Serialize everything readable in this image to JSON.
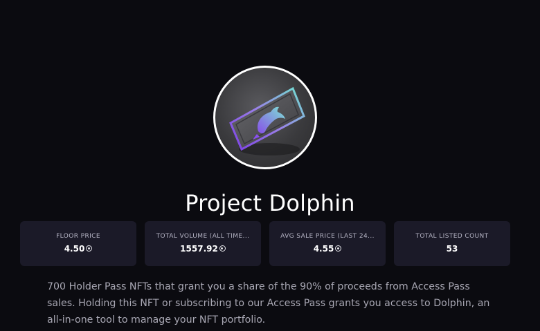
{
  "project": {
    "name": "Project Dolphin",
    "description": "700 Holder Pass NFTs that grant you a share of the 90% of proceeds from Access Pass sales. Holding this NFT or subscribing to our Access Pass grants you access to Dolphin, an all-in-one tool to manage your NFT portfolio.",
    "avatar_icon": "dolphin-pass-card-icon"
  },
  "stats": [
    {
      "label": "FLOOR PRICE",
      "value": "4.50",
      "currency_icon": "sol-icon"
    },
    {
      "label": "TOTAL VOLUME (ALL TIME...",
      "value": "1557.92",
      "currency_icon": "sol-icon"
    },
    {
      "label": "AVG SALE PRICE (LAST 24...",
      "value": "4.55",
      "currency_icon": "sol-icon"
    },
    {
      "label": "TOTAL LISTED COUNT",
      "value": "53"
    }
  ],
  "colors": {
    "background": "#0b0b10",
    "card": "#1b1a28",
    "accent_purple": "#7b3fe4",
    "accent_teal": "#6fe3d0"
  }
}
